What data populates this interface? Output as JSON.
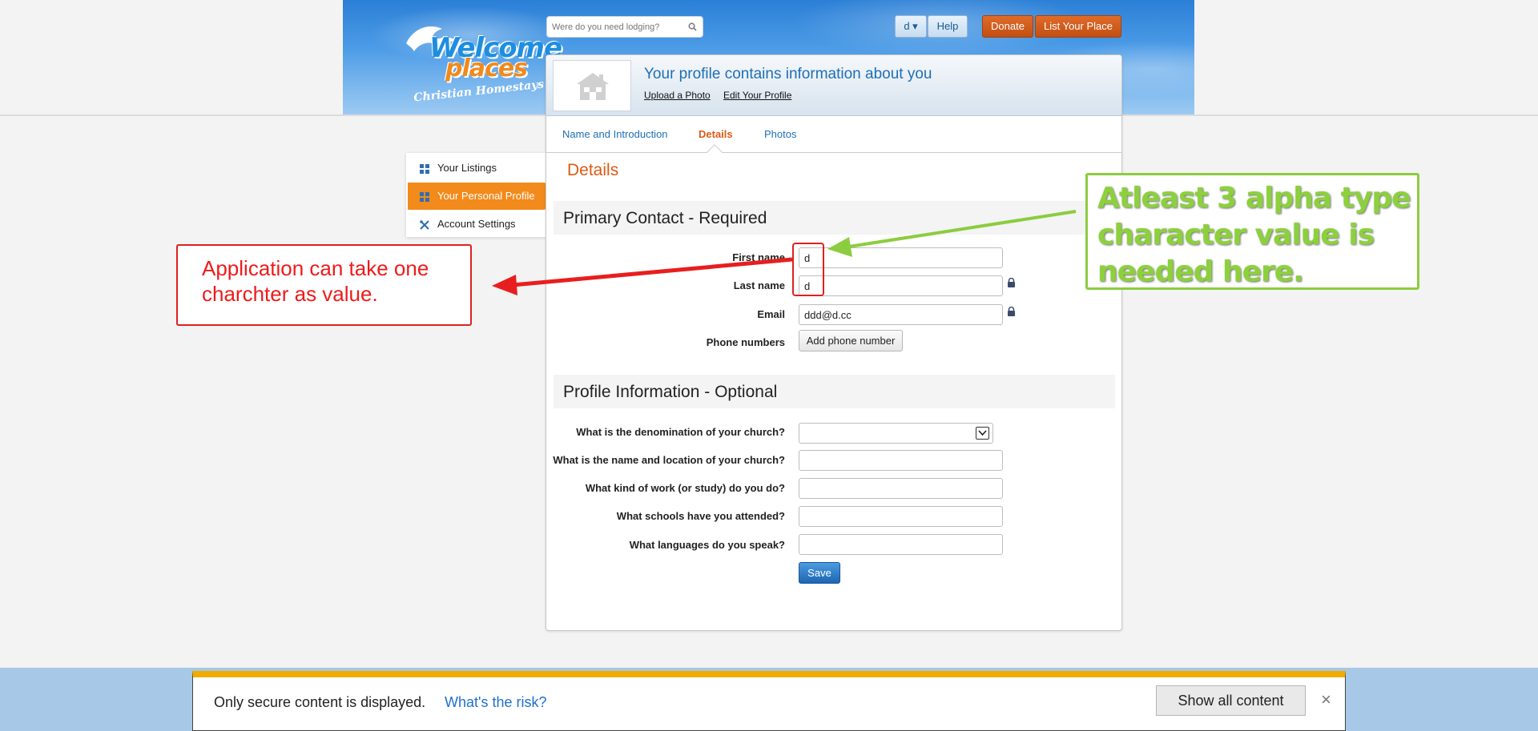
{
  "header": {
    "logo": {
      "line1": "Welcome",
      "line2": "places",
      "tagline": "Christian Homestays"
    },
    "search_placeholder": "Were do you need lodging?",
    "user_menu_label": "d ▾",
    "help_label": "Help",
    "donate_label": "Donate",
    "list_place_label": "List Your Place"
  },
  "profile": {
    "title": "Your profile contains information about you",
    "upload_photo_link": "Upload a Photo",
    "edit_profile_link": "Edit Your Profile"
  },
  "tabs": [
    {
      "label": "Name and Introduction",
      "active": false
    },
    {
      "label": "Details",
      "active": true
    },
    {
      "label": "Photos",
      "active": false
    }
  ],
  "sidebar": {
    "items": [
      {
        "label": "Your Listings",
        "icon": "grid-icon",
        "active": false
      },
      {
        "label": "Your Personal Profile",
        "icon": "grid-icon",
        "active": true
      },
      {
        "label": "Account Settings",
        "icon": "tools-icon",
        "active": false
      }
    ]
  },
  "details": {
    "heading": "Details",
    "primary_contact": {
      "heading": "Primary Contact - Required",
      "first_name_label": "First name",
      "first_name_value": "d",
      "last_name_label": "Last name",
      "last_name_value": "d",
      "email_label": "Email",
      "email_value": "ddd@d.cc",
      "phone_label": "Phone numbers",
      "add_phone_button": "Add phone number"
    },
    "profile_info": {
      "heading": "Profile Information - Optional",
      "denomination_label": "What is the denomination of your church?",
      "denomination_value": "",
      "church_label": "What is the name and location of your church?",
      "church_value": "",
      "work_label": "What kind of work (or study) do you do?",
      "work_value": "",
      "schools_label": "What schools have you attended?",
      "schools_value": "",
      "languages_label": "What languages do you speak?",
      "languages_value": ""
    },
    "save_button": "Save"
  },
  "annotations": {
    "red_note": "Application can take one charchter as value.",
    "green_note": "Atleast 3 alpha type character value is needed here.",
    "red_color": "#e02020",
    "green_color": "#8ccc3f"
  },
  "security_bar": {
    "message": "Only secure content is displayed.",
    "risk_link": "What's the risk?",
    "show_all_button": "Show all content",
    "close_symbol": "×"
  },
  "colors": {
    "accent_orange": "#dc5a14",
    "link_blue": "#1f6fb5",
    "warning_yellow": "#f0ad00"
  }
}
